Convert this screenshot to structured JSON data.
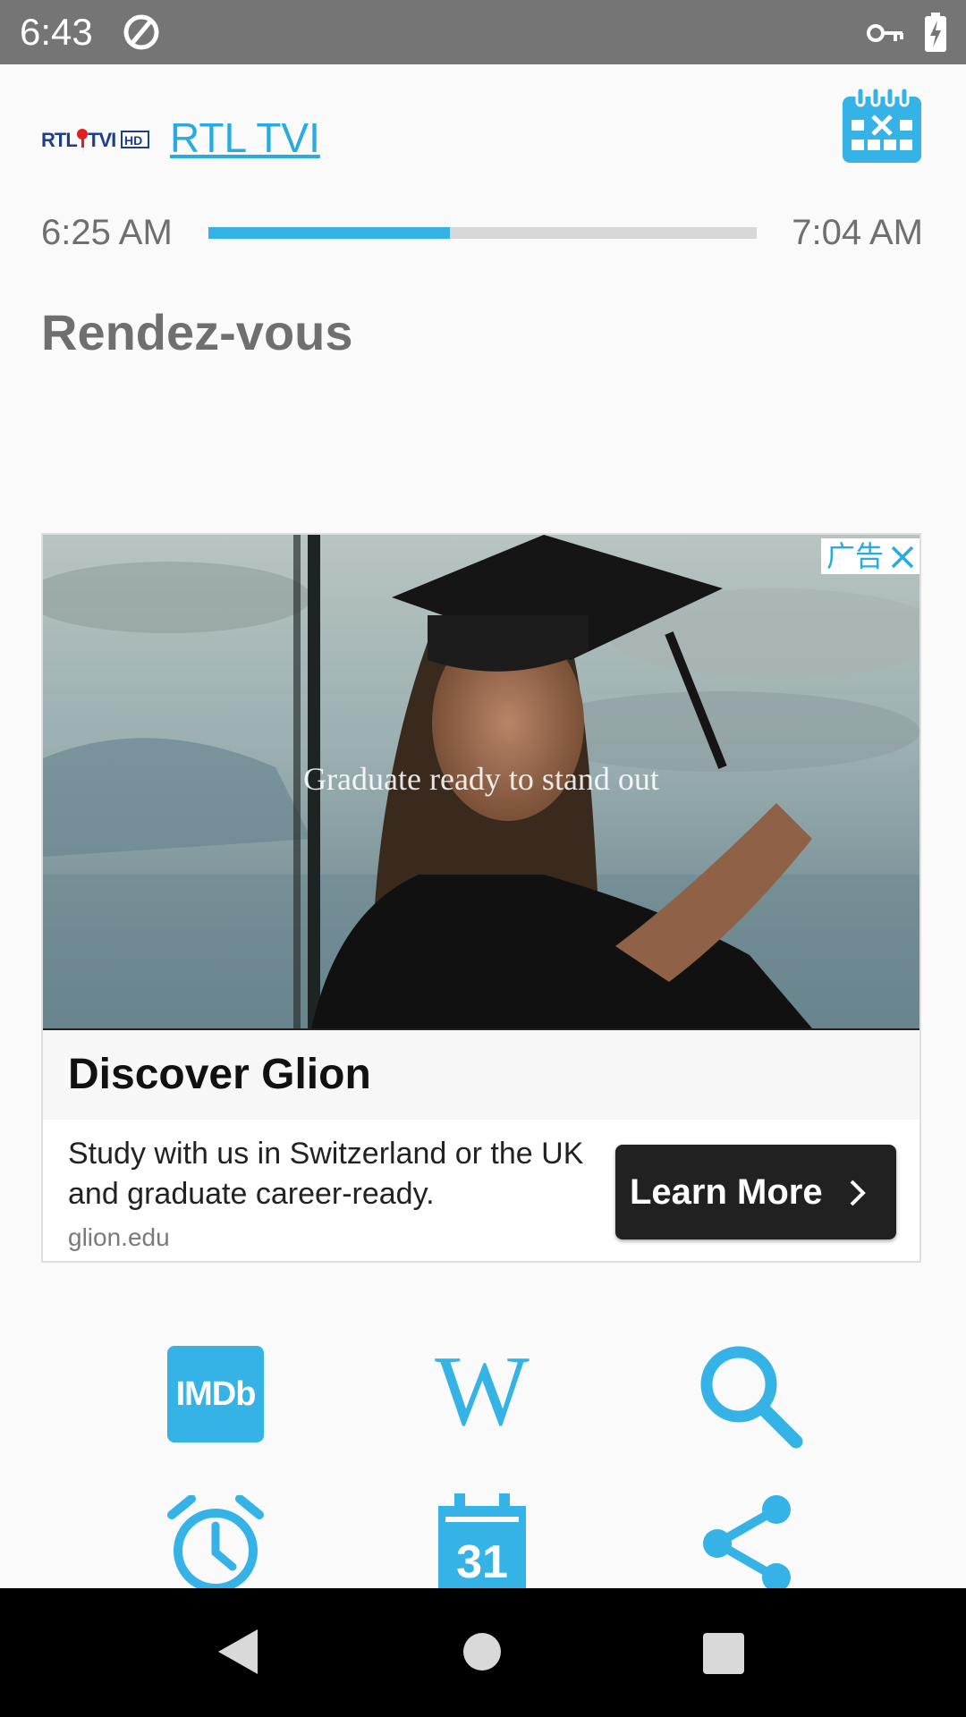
{
  "status_bar": {
    "time": "6:43",
    "icons": [
      "do-not-disturb-icon",
      "vpn-key-icon",
      "battery-charging-icon"
    ]
  },
  "header": {
    "channel_logo_text": "RTL TVI HD",
    "channel_name": "RTL TVI",
    "calendar_icon": "calendar-cancel-icon"
  },
  "program": {
    "start_time": "6:25 AM",
    "end_time": "7:04 AM",
    "progress": 0.44,
    "title": "Rendez-vous"
  },
  "ad": {
    "badge_label": "广告",
    "overlay_text": "Graduate ready to stand out",
    "headline": "Discover Glion",
    "body": "Study with us in Switzerland or the UK and graduate career-ready.",
    "domain": "glion.edu",
    "cta_label": "Learn More"
  },
  "actions": {
    "imdb_label": "IMDb",
    "wiki_icon": "wikipedia-icon",
    "search_icon": "search-icon",
    "alarm_icon": "alarm-icon",
    "calendar_day": "31",
    "share_icon": "share-icon"
  },
  "colors": {
    "accent": "#35b2e6",
    "status_bar": "#757575",
    "text_gray": "#6f6f6f",
    "nav_bar": "#000000"
  }
}
